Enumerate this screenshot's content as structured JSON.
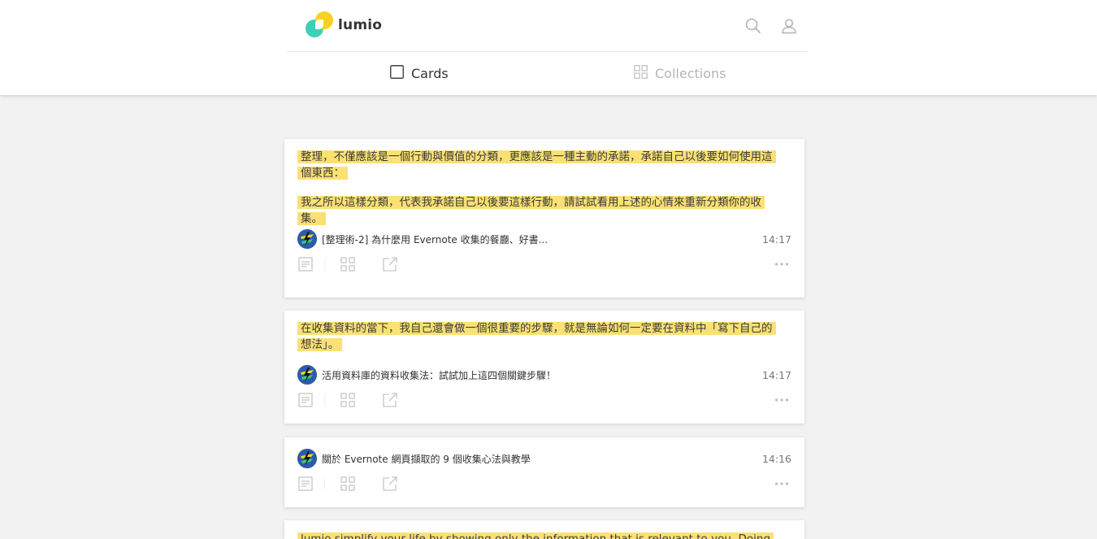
{
  "app": {
    "logo_text": "lumio",
    "colors": {
      "accent_teal": "#3bd1b6",
      "accent_yellow": "#f6d21e",
      "highlight": "#fbe174"
    }
  },
  "header": {
    "icons": {
      "search": "search-icon",
      "account": "user-icon"
    },
    "tabs": [
      {
        "label": "Cards",
        "icon": "card-icon",
        "active": true
      },
      {
        "label": "Collections",
        "icon": "grid-icon",
        "active": false
      }
    ]
  },
  "cards": [
    {
      "quote": [
        "整理，不僅應該是一個行動與價值的分類，更應該是一種主動的承諾，承諾自己以後要如何使用這個東西：",
        "我之所以這樣分類，代表我承諾自己以後要這樣行動，請試試看用上述的心情來重新分類你的收集。"
      ],
      "source_title": "[整理術-2] 為什麼用 Evernote 收集的餐廳、好書...",
      "time": "14:17"
    },
    {
      "quote": [
        "在收集資料的當下，我自己還會做一個很重要的步驟，就是無論如何一定要在資料中「寫下自己的想法」。"
      ],
      "source_title": "活用資料庫的資料收集法：試試加上這四個關鍵步驟！",
      "time": "14:17"
    },
    {
      "quote": [],
      "source_title": "關於 Evernote 網頁擷取的 9 個收集心法與教學",
      "time": "14:16"
    },
    {
      "quote": [
        "lumio simplify your life by showing only the information that is relevant to you. Doing"
      ],
      "source_title": "",
      "time": ""
    }
  ]
}
